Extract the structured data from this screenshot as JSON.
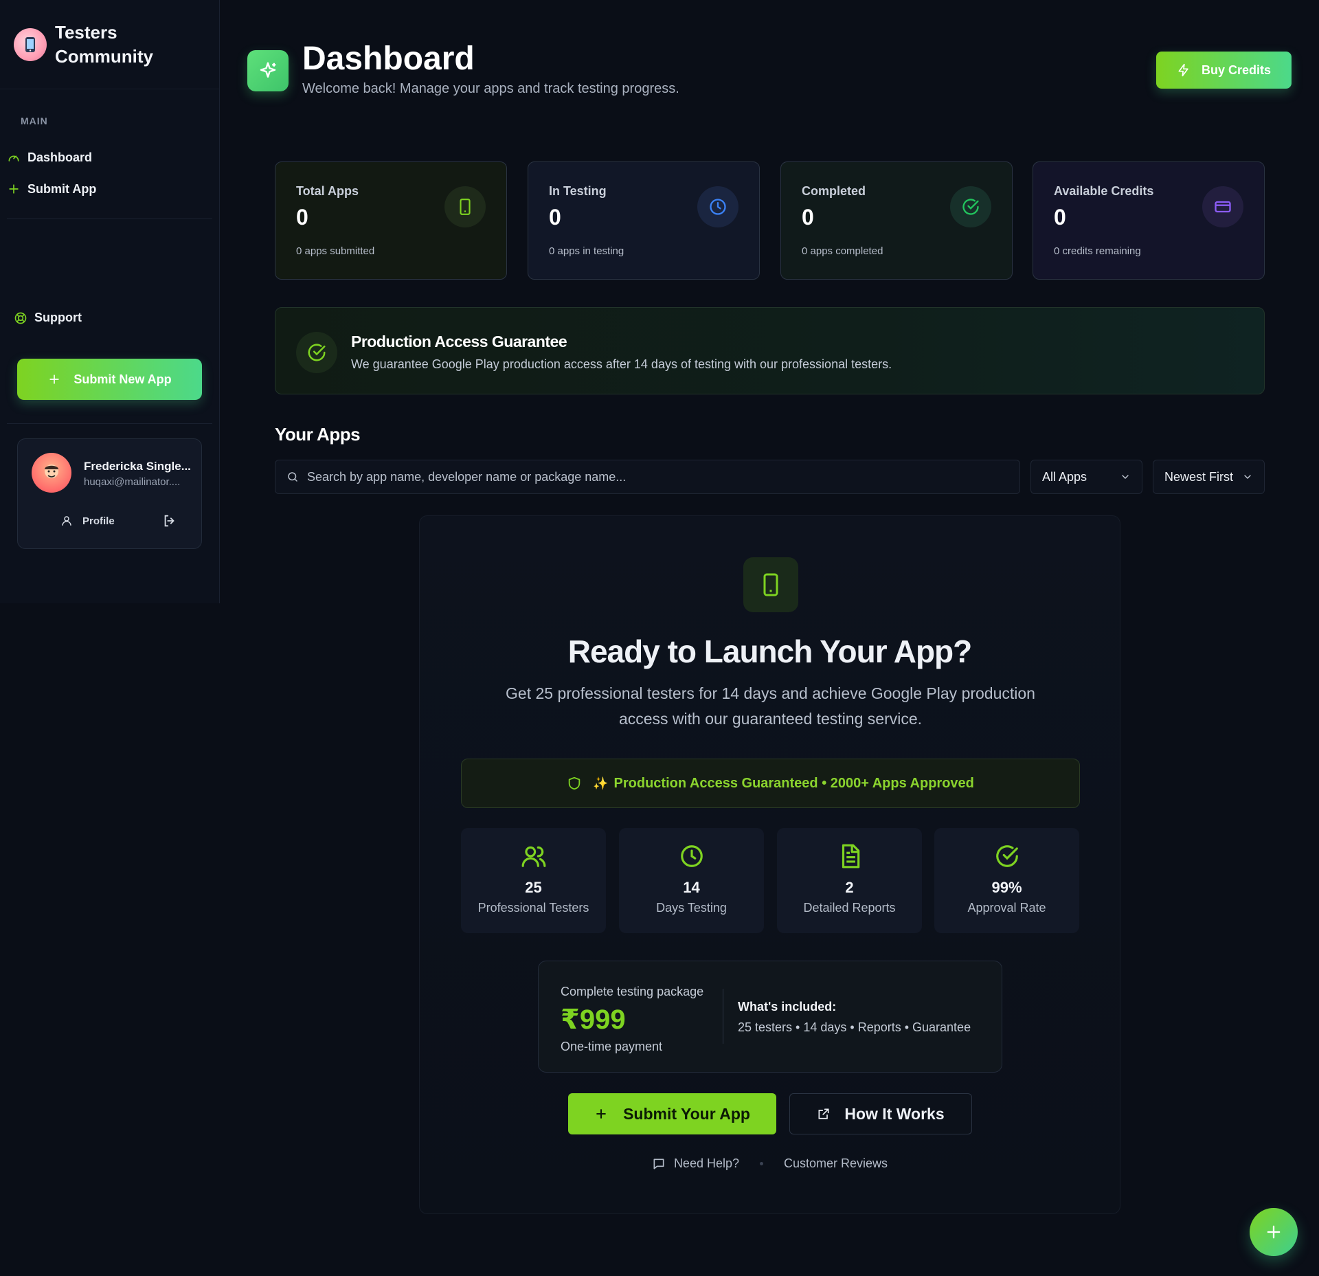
{
  "brand": {
    "name": "Testers Community"
  },
  "sidebar": {
    "section_label": "MAIN",
    "items": [
      {
        "label": "Dashboard",
        "icon": "gauge-icon"
      },
      {
        "label": "Submit App",
        "icon": "plus-icon"
      }
    ],
    "support_label": "Support",
    "submit_button": "Submit New App",
    "user": {
      "name": "Fredericka Single...",
      "email": "huqaxi@mailinator....",
      "profile_label": "Profile"
    }
  },
  "header": {
    "title": "Dashboard",
    "subtitle": "Welcome back! Manage your apps and track testing progress.",
    "buy_credits": "Buy Credits"
  },
  "stats": [
    {
      "label": "Total Apps",
      "value": "0",
      "sub": "0 apps submitted",
      "icon": "phone-icon",
      "color": "#7ed321"
    },
    {
      "label": "In Testing",
      "value": "0",
      "sub": "0 apps in testing",
      "icon": "clock-icon",
      "color": "#3b82f6"
    },
    {
      "label": "Completed",
      "value": "0",
      "sub": "0 apps completed",
      "icon": "check-circle-icon",
      "color": "#22c55e"
    },
    {
      "label": "Available Credits",
      "value": "0",
      "sub": "0 credits remaining",
      "icon": "credit-card-icon",
      "color": "#8b5cf6"
    }
  ],
  "guarantee": {
    "title": "Production Access Guarantee",
    "text": "We guarantee Google Play production access after 14 days of testing with our professional testers."
  },
  "your_apps": {
    "title": "Your Apps",
    "search_placeholder": "Search by app name, developer name or package name...",
    "filter_value": "All Apps",
    "sort_value": "Newest First"
  },
  "launch": {
    "title": "Ready to Launch Your App?",
    "description": "Get 25 professional testers for 14 days and achieve Google Play production access with our guaranteed testing service.",
    "pill": "Production Access Guaranteed • 2000+ Apps Approved",
    "features": [
      {
        "value": "25",
        "label": "Professional Testers",
        "icon": "users-icon"
      },
      {
        "value": "14",
        "label": "Days Testing",
        "icon": "clock-icon"
      },
      {
        "value": "2",
        "label": "Detailed Reports",
        "icon": "document-icon"
      },
      {
        "value": "99%",
        "label": "Approval Rate",
        "icon": "check-circle-icon"
      }
    ],
    "package": {
      "label": "Complete testing package",
      "price": "₹999",
      "note": "One-time payment",
      "included_title": "What's included:",
      "included_text": "25 testers • 14 days • Reports • Guarantee"
    },
    "cta_primary": "Submit Your App",
    "cta_secondary": "How It Works",
    "help": "Need Help?",
    "reviews": "Customer Reviews"
  },
  "colors": {
    "accent": "#7ed321",
    "accent2": "#4cd98a",
    "background": "#0a0e17"
  }
}
